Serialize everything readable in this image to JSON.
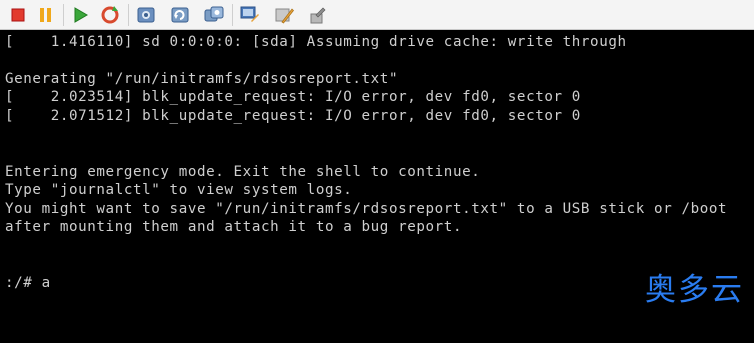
{
  "toolbar": {
    "buttons": [
      {
        "name": "stop-button",
        "icon": "stop-square-icon",
        "color": "#e23b2e"
      },
      {
        "name": "pause-button",
        "icon": "pause-icon",
        "color": "#f0a81a"
      },
      {
        "name": "play-button",
        "icon": "play-icon",
        "color": "#3aa63a"
      },
      {
        "name": "reset-button",
        "icon": "reset-icon",
        "color": "#d84a2e"
      },
      {
        "name": "snapshot-button",
        "icon": "snapshot-icon"
      },
      {
        "name": "revert-snapshot-button",
        "icon": "revert-snapshot-icon"
      },
      {
        "name": "snapshot-manager-button",
        "icon": "snapshot-manager-icon"
      },
      {
        "name": "console-view-button",
        "icon": "console-view-icon"
      },
      {
        "name": "vm-settings-button",
        "icon": "settings-icon"
      },
      {
        "name": "tools-button",
        "icon": "wrench-icon"
      }
    ]
  },
  "console": {
    "lines": [
      "[    1.416110] sd 0:0:0:0: [sda] Assuming drive cache: write through",
      "",
      "Generating \"/run/initramfs/rdsosreport.txt\"",
      "[    2.023514] blk_update_request: I/O error, dev fd0, sector 0",
      "[    2.071512] blk_update_request: I/O error, dev fd0, sector 0",
      "",
      "",
      "Entering emergency mode. Exit the shell to continue.",
      "Type \"journalctl\" to view system logs.",
      "You might want to save \"/run/initramfs/rdsosreport.txt\" to a USB stick or /boot",
      "after mounting them and attach it to a bug report.",
      "",
      "",
      ":/# a"
    ]
  },
  "watermark": {
    "text": "奥多云",
    "color": "#2a7cf0"
  }
}
